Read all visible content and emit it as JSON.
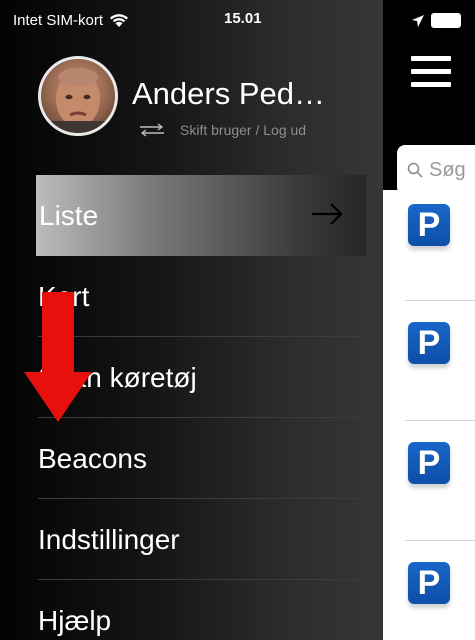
{
  "status_bar": {
    "carrier": "Intet SIM-kort",
    "time": "15.01",
    "icons": [
      "wifi-icon",
      "location-icon",
      "battery-icon"
    ]
  },
  "drawer": {
    "user": {
      "name": "Anders Ped…",
      "switch_text": "Skift bruger / Log ud"
    },
    "menu": [
      {
        "label": "Liste",
        "active": true
      },
      {
        "label": "Kort",
        "active": false
      },
      {
        "label": "Scan køretøj",
        "active": false
      },
      {
        "label": "Beacons",
        "active": false
      },
      {
        "label": "Indstillinger",
        "active": false
      },
      {
        "label": "Hjælp",
        "active": false
      }
    ]
  },
  "main": {
    "search_placeholder": "Søg",
    "parking_icon_letter": "P",
    "list_count_visible": 4
  },
  "colors": {
    "accent_parking": "#0d4fa8",
    "annotation_arrow": "#e8100c"
  }
}
